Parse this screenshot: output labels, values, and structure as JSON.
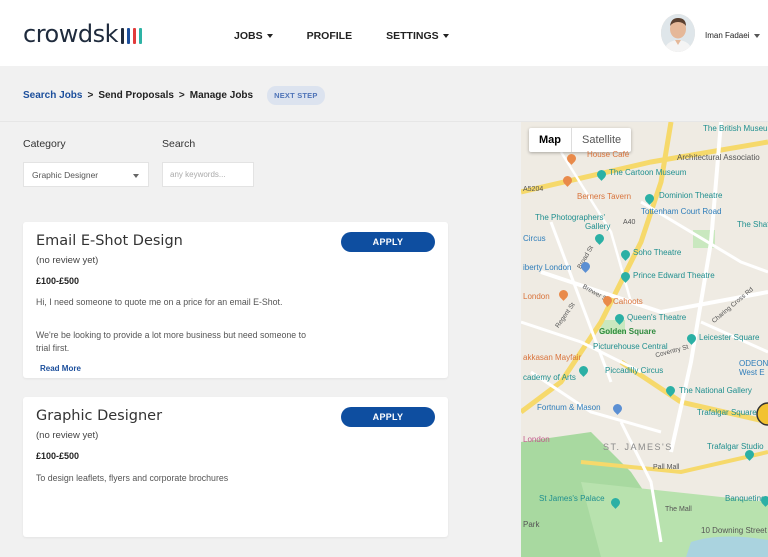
{
  "brand": {
    "name": "crowdsk",
    "bar_colors": [
      "#1f2b3d",
      "#1c4f9c",
      "#e23b3b",
      "#2db3a5"
    ]
  },
  "nav": {
    "jobs": "JOBS",
    "profile": "PROFILE",
    "settings": "SETTINGS"
  },
  "user": {
    "name": "Iman Fadaei"
  },
  "breadcrumb": {
    "step1": "Search Jobs",
    "step2": "Send Proposals",
    "step3": "Manage Jobs",
    "sep": ">",
    "next": "NEXT STEP"
  },
  "filters": {
    "category_label": "Category",
    "category_value": "Graphic Designer",
    "search_label": "Search",
    "search_placeholder": "any keywords..."
  },
  "jobs": [
    {
      "title": "Email E-Shot Design",
      "review": "(no review yet)",
      "price": "£100-£500",
      "desc1": "Hi, I need someone to quote me on a price for an email E-Shot.",
      "desc2": "We're be looking to provide a lot more business but need someone to trial first.",
      "more": "Read More",
      "apply": "APPLY"
    },
    {
      "title": "Graphic Designer",
      "review": "(no review yet)",
      "price": "£100-£500",
      "desc1": "To design leaflets, flyers and corporate brochures",
      "apply": "APPLY"
    }
  ],
  "map": {
    "tab_map": "Map",
    "tab_satellite": "Satellite",
    "places": {
      "british_museum": "The British Museum",
      "architectural": "Architectural Associatio",
      "house_cafe": "House Café",
      "cartoon_museum": "The Cartoon Museum",
      "a5204": "A5204",
      "berners": "Berners Tavern",
      "dominion": "Dominion Theatre",
      "photographers1": "The Photographers'",
      "photographers2": "Gallery",
      "tcr": "Tottenham Court Road",
      "a40": "A40",
      "shaftesbury": "The Shaftesbu",
      "circus": "Circus",
      "soho": "Soho Theatre",
      "liberty": "iberty London",
      "prince_edward": "Prince Edward Theatre",
      "london": "London",
      "cahoots": "Cahoots",
      "queens": "Queen's Theatre",
      "golden": "Golden Square",
      "leicester": "Leicester Square",
      "picturehouse": "Picturehouse Central",
      "akkasan": "akkasan Mayfair",
      "odeon1": "ODEON",
      "odeon2": "West E",
      "academy": "cademy of Arts",
      "piccadilly": "Piccadilly Circus",
      "national": "The National Gallery",
      "fortnum": "Fortnum & Mason",
      "trafalgar": "Trafalgar Square",
      "london2": "London",
      "st_james": "ST. JAMES'S",
      "trafalgar_studio": "Trafalgar Studio",
      "pall_mall": "Pall Mall",
      "st_james_palace": "St James's Palace",
      "banqueting": "Banqueting",
      "park": "Park",
      "the_mall": "The Mall",
      "downing": "10 Downing Street",
      "regent": "Regent St",
      "brewer": "Brewer St",
      "coventry": "Coventry St",
      "broad_st": "Broad St",
      "charing": "Charing Cross Rd"
    }
  }
}
